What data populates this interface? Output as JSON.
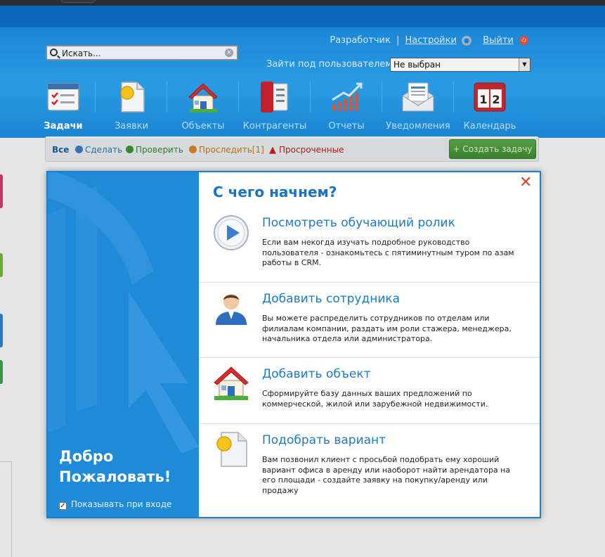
{
  "header": {
    "search_placeholder": "Искать...",
    "links": {
      "developer": "Разработчик",
      "separator": "|",
      "settings": "Настройки",
      "logout": "Выйти"
    },
    "login_as_label": "Зайти под пользователем:",
    "login_as_value": "Не выбран"
  },
  "nav": [
    {
      "label": "Задачи",
      "icon": "tasks-icon",
      "active": true
    },
    {
      "label": "Заявки",
      "icon": "requests-icon"
    },
    {
      "label": "Объекты",
      "icon": "house-icon"
    },
    {
      "label": "Контрагенты",
      "icon": "contacts-book-icon"
    },
    {
      "label": "Отчеты",
      "icon": "chart-icon"
    },
    {
      "label": "Уведомления",
      "icon": "envelope-icon"
    },
    {
      "label": "Календарь",
      "icon": "calendar-icon"
    }
  ],
  "filters": {
    "all": "Все",
    "todo": "Сделать",
    "check": "Проверить",
    "track": "Проследить[1]",
    "overdue": "Просроченные",
    "create_button": "+ Создать задачу"
  },
  "modal": {
    "title": "С чего начнем?",
    "welcome_line1": "Добро",
    "welcome_line2": "Пожаловать!",
    "show_on_login": "Показывать при входе",
    "options": [
      {
        "title": "Посмотреть обучающий ролик",
        "icon": "play-icon",
        "desc": "Если вам некогда изучать подробное руководство пользователя - ознакомьтесь с пятиминутным туром по азам работы в CRM."
      },
      {
        "title": "Добавить сотрудника",
        "icon": "employee-avatar-icon",
        "desc": "Вы можете распределить сотрудников по отделам или филиалам компании, раздать им роли стажера, менеджера, начальника отдела или администратора."
      },
      {
        "title": "Добавить объект",
        "icon": "house-icon",
        "desc": "Сформируйте базу данных ваших предложений по коммерческой, жилой или зарубежной недвижимости."
      },
      {
        "title": "Подобрать вариант",
        "icon": "document-sun-icon",
        "desc": "Вам позвонил клиент с просьбой подобрать ему хороший вариант офиса в аренду или наоборот найти арендатора на его площади - создайте заявку на покупку/аренду или продажу"
      }
    ]
  },
  "colors": {
    "header_blue": "#1b86d6",
    "modal_blue": "#1f8ad8",
    "link_blue": "#1a7bcd",
    "create_green": "#4a9f3b",
    "overdue_red": "#d21e1e"
  }
}
